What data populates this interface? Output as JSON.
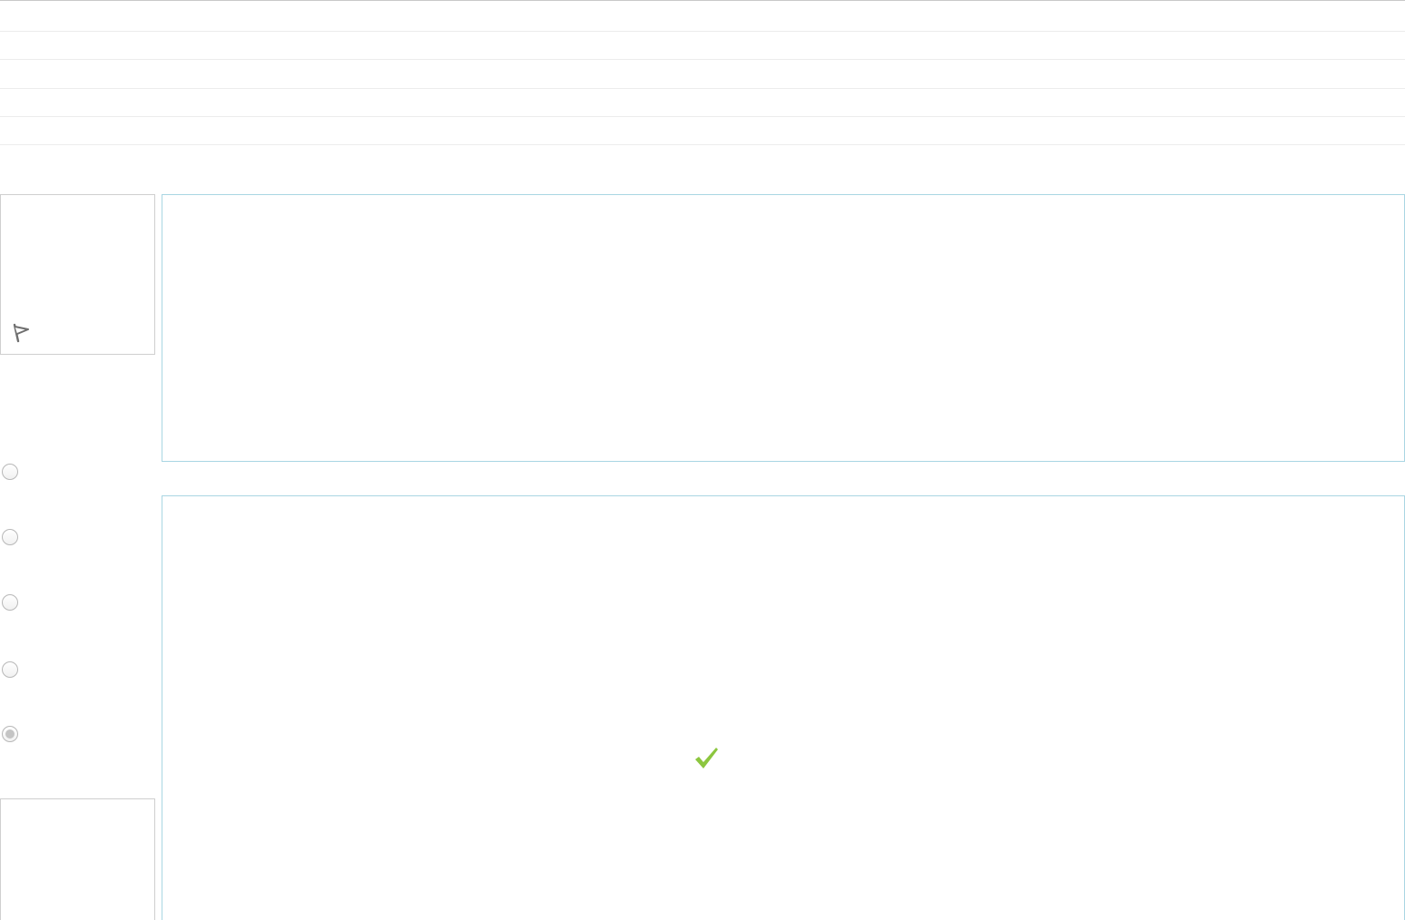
{
  "question": {
    "info_label": "",
    "text": "",
    "feedback_text": "",
    "answer_options": [
      {
        "label": "",
        "checked": false
      },
      {
        "label": "",
        "checked": false
      },
      {
        "label": "",
        "checked": false
      },
      {
        "label": "",
        "checked": false
      },
      {
        "label": "",
        "checked": true
      }
    ]
  },
  "icons": {
    "flag": "flag-icon",
    "correct": "checkmark-icon"
  },
  "colors": {
    "panel_border": "#a9d6e3",
    "correct_mark": "#8cc63f",
    "radio_selected": "#c4c4c4"
  }
}
